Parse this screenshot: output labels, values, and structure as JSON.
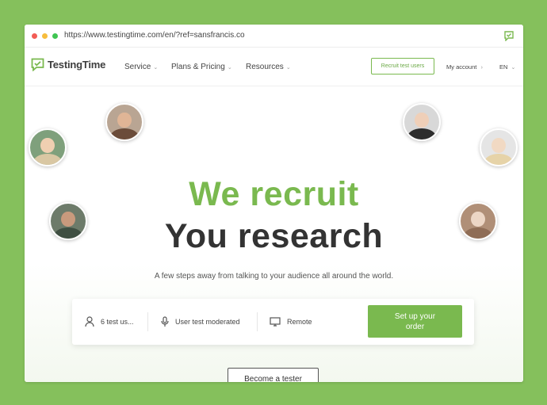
{
  "browser": {
    "url": "https://www.testingtime.com/en/?ref=sansfrancis.co"
  },
  "header": {
    "logo": {
      "part1": "Testing",
      "part2": "Time"
    },
    "nav": [
      {
        "label": "Service"
      },
      {
        "label": "Plans & Pricing"
      },
      {
        "label": "Resources"
      }
    ],
    "recruit_button": "Recruit test users",
    "my_account": "My account",
    "language": "EN"
  },
  "hero": {
    "headline_line1": "We recruit",
    "headline_line2": "You research",
    "subtitle": "A few steps away from talking to your audience all around the world.",
    "order": {
      "test_users": "6 test us...",
      "test_type": "User test moderated",
      "location": "Remote",
      "cta": "Set up your order"
    },
    "become_tester": "Become a tester"
  },
  "colors": {
    "brand_green": "#7ab94f",
    "page_background": "#85c05c",
    "headline_dark": "#333333"
  }
}
